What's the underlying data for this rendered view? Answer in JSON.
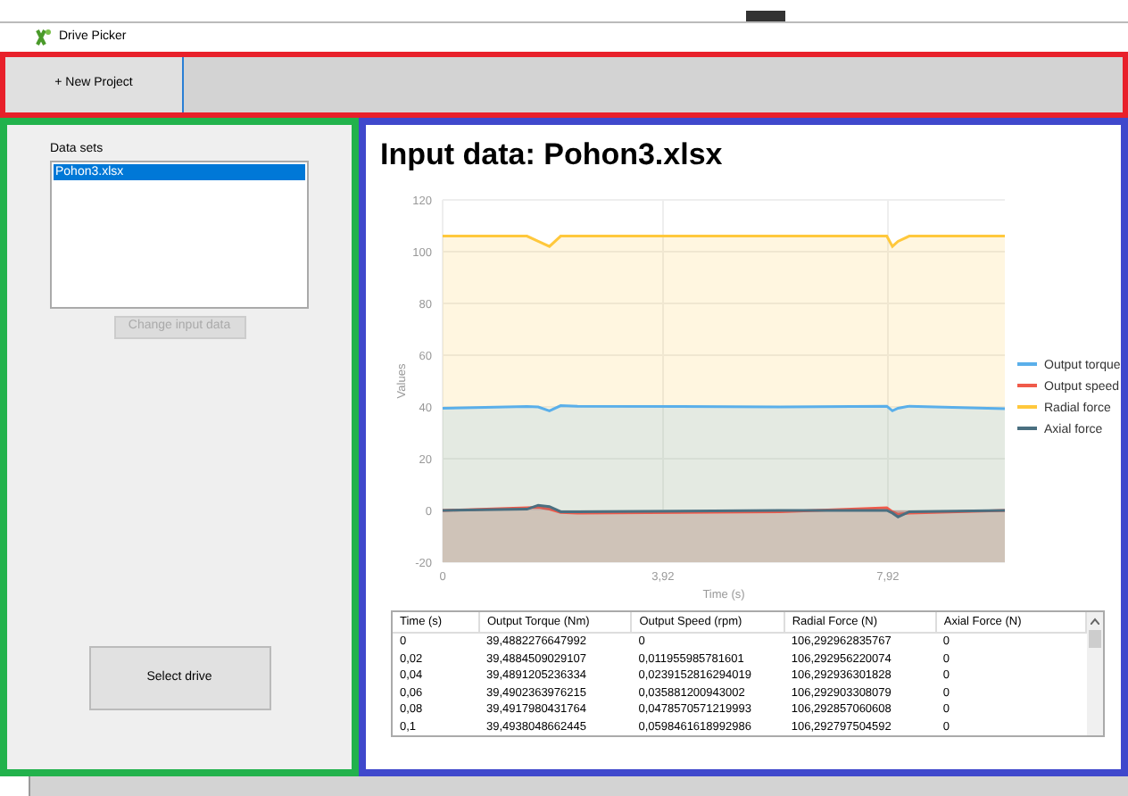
{
  "window": {
    "title": "Drive Picker"
  },
  "toolbar": {
    "new_project": "+ New Project"
  },
  "sidebar": {
    "list_label": "Data sets",
    "data_sets": [
      {
        "label": "Pohon3.xlsx",
        "selected": true
      }
    ],
    "change_button": {
      "label": "Change input data",
      "disabled": true
    },
    "select_button": {
      "label": "Select drive"
    }
  },
  "main": {
    "title": "Input data: Pohon3.xlsx",
    "chart_data": {
      "type": "area",
      "grid": true,
      "legend": true,
      "xlabel": "Time (s)",
      "ylabel": "Values",
      "xlim": [
        0,
        10
      ],
      "ylim": [
        -20,
        120
      ],
      "xticks": [
        0,
        {
          "value": 3.92,
          "label": "3,92"
        },
        {
          "value": 7.92,
          "label": "7,92"
        }
      ],
      "yticks": [
        -20,
        0,
        20,
        40,
        60,
        80,
        100,
        120
      ],
      "x": [
        0,
        1.5,
        1.7,
        1.9,
        2.1,
        2.4,
        6,
        7.9,
        8.0,
        8.1,
        8.3,
        10
      ],
      "series": [
        {
          "name": "Output torque",
          "color": "#5aafea",
          "values": [
            39.5,
            40.2,
            40.0,
            38.5,
            40.5,
            40.3,
            40.0,
            40.3,
            38.5,
            39.5,
            40.3,
            39.3
          ]
        },
        {
          "name": "Output speed",
          "color": "#f05a4a",
          "values": [
            0,
            1,
            1.2,
            0.5,
            -0.8,
            -1,
            -0.5,
            1,
            -0.5,
            -1.5,
            -1,
            0
          ]
        },
        {
          "name": "Radial force",
          "color": "#ffc83c",
          "values": [
            106,
            106,
            104,
            102,
            106,
            106,
            106,
            106,
            102,
            104,
            106,
            106
          ]
        },
        {
          "name": "Axial force",
          "color": "#4a6f80",
          "values": [
            0,
            0.5,
            2,
            1.5,
            -0.5,
            -0.5,
            0,
            0,
            -1,
            -2.5,
            -0.5,
            0
          ]
        }
      ]
    },
    "table": {
      "columns": [
        "Time (s)",
        "Output Torque (Nm)",
        "Output Speed (rpm)",
        "Radial Force (N)",
        "Axial Force (N)"
      ],
      "rows": [
        [
          "0",
          "39,4882276647992",
          "0",
          "106,292962835767",
          "0"
        ],
        [
          "0,02",
          "39,4884509029107",
          "0,011955985781601",
          "106,292956220074",
          "0"
        ],
        [
          "0,04",
          "39,4891205236334",
          "0,0239152816294019",
          "106,292936301828",
          "0"
        ],
        [
          "0,06",
          "39,4902363976215",
          "0,035881200943002",
          "106,292903308079",
          "0"
        ],
        [
          "0,08",
          "39,4917980431764",
          "0,0478570571219993",
          "106,292857060608",
          "0"
        ],
        [
          "0,1",
          "39,4938048662445",
          "0,0598461618992986",
          "106,292797504592",
          "0"
        ]
      ]
    }
  }
}
